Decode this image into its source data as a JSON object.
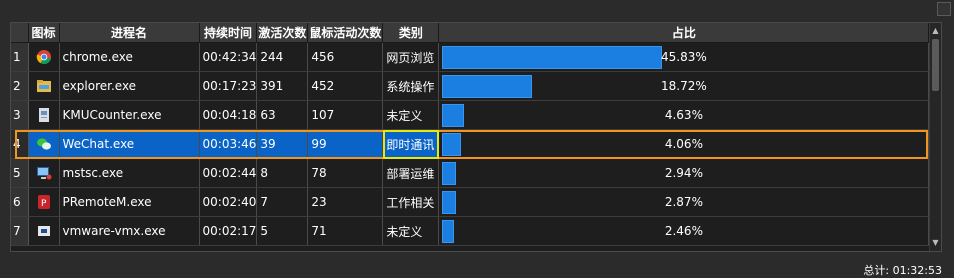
{
  "columns": {
    "index": "",
    "icon": "图标",
    "name": "进程名",
    "duration": "持续时间",
    "activations": "激活次数",
    "mouse": "鼠标活动次数",
    "category": "类别",
    "ratio": "占比"
  },
  "rows": [
    {
      "index": "1",
      "icon": "chrome-icon",
      "name": "chrome.exe",
      "duration": "00:42:34",
      "activations": "244",
      "mouse": "456",
      "category": "网页浏览",
      "ratio_label": "45.83%",
      "ratio": 0.4583
    },
    {
      "index": "2",
      "icon": "explorer-icon",
      "name": "explorer.exe",
      "duration": "00:17:23",
      "activations": "391",
      "mouse": "452",
      "category": "系统操作",
      "ratio_label": "18.72%",
      "ratio": 0.1872
    },
    {
      "index": "3",
      "icon": "kmucounter-icon",
      "name": "KMUCounter.exe",
      "duration": "00:04:18",
      "activations": "63",
      "mouse": "107",
      "category": "未定义",
      "ratio_label": "4.63%",
      "ratio": 0.0463
    },
    {
      "index": "4",
      "icon": "wechat-icon",
      "name": "WeChat.exe",
      "duration": "00:03:46",
      "activations": "39",
      "mouse": "99",
      "category": "即时通讯",
      "ratio_label": "4.06%",
      "ratio": 0.0406,
      "selected": true
    },
    {
      "index": "5",
      "icon": "mstsc-icon",
      "name": "mstsc.exe",
      "duration": "00:02:44",
      "activations": "8",
      "mouse": "78",
      "category": "部署运维",
      "ratio_label": "2.94%",
      "ratio": 0.0294
    },
    {
      "index": "6",
      "icon": "premotem-icon",
      "name": "PRemoteM.exe",
      "duration": "00:02:40",
      "activations": "7",
      "mouse": "23",
      "category": "工作相关",
      "ratio_label": "2.87%",
      "ratio": 0.0287
    },
    {
      "index": "7",
      "icon": "vmware-icon",
      "name": "vmware-vmx.exe",
      "duration": "00:02:17",
      "activations": "5",
      "mouse": "71",
      "category": "未定义",
      "ratio_label": "2.46%",
      "ratio": 0.0246
    }
  ],
  "footer": {
    "total": "总计:  01:32:53"
  },
  "colors": {
    "bar": "#1a7fe0",
    "selected_row": "#0a64c8",
    "selection_outline": "#f0961e",
    "cell_focus": "#e8e80a"
  }
}
